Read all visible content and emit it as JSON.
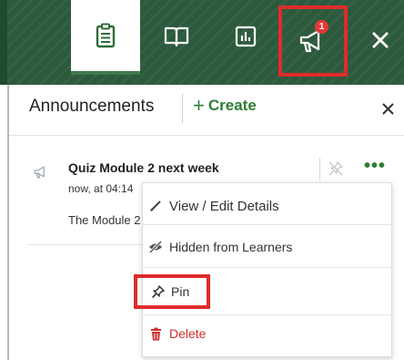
{
  "topbar": {
    "tabs": [
      {
        "name": "notes",
        "icon": "clipboard-icon",
        "active": true
      },
      {
        "name": "book",
        "icon": "book-icon",
        "active": false
      },
      {
        "name": "stats",
        "icon": "bar-chart-icon",
        "active": false
      },
      {
        "name": "announcements",
        "icon": "megaphone-icon",
        "active": false,
        "badge": "1"
      }
    ],
    "close_icon": "close-icon"
  },
  "panel": {
    "title": "Announcements",
    "create_label": "Create",
    "create_plus": "+",
    "close_icon": "close-icon"
  },
  "announcement": {
    "icon": "megaphone-icon",
    "title": "Quiz Module 2 next week",
    "time": "now, at 04:14",
    "body": "The Module 2",
    "more_label": "•••"
  },
  "menu": {
    "items": [
      {
        "label": "View / Edit Details",
        "icon": "pencil-icon"
      },
      {
        "label": "Hidden from Learners",
        "icon": "eye-off-icon"
      },
      {
        "label": "Pin",
        "icon": "pin-icon"
      },
      {
        "label": "Delete",
        "icon": "trash-icon"
      }
    ]
  },
  "colors": {
    "topbar": "#2d5a3d",
    "accent_green": "#2e7d32",
    "highlight_red": "#e02b2b",
    "delete_red": "#d32f2f"
  }
}
